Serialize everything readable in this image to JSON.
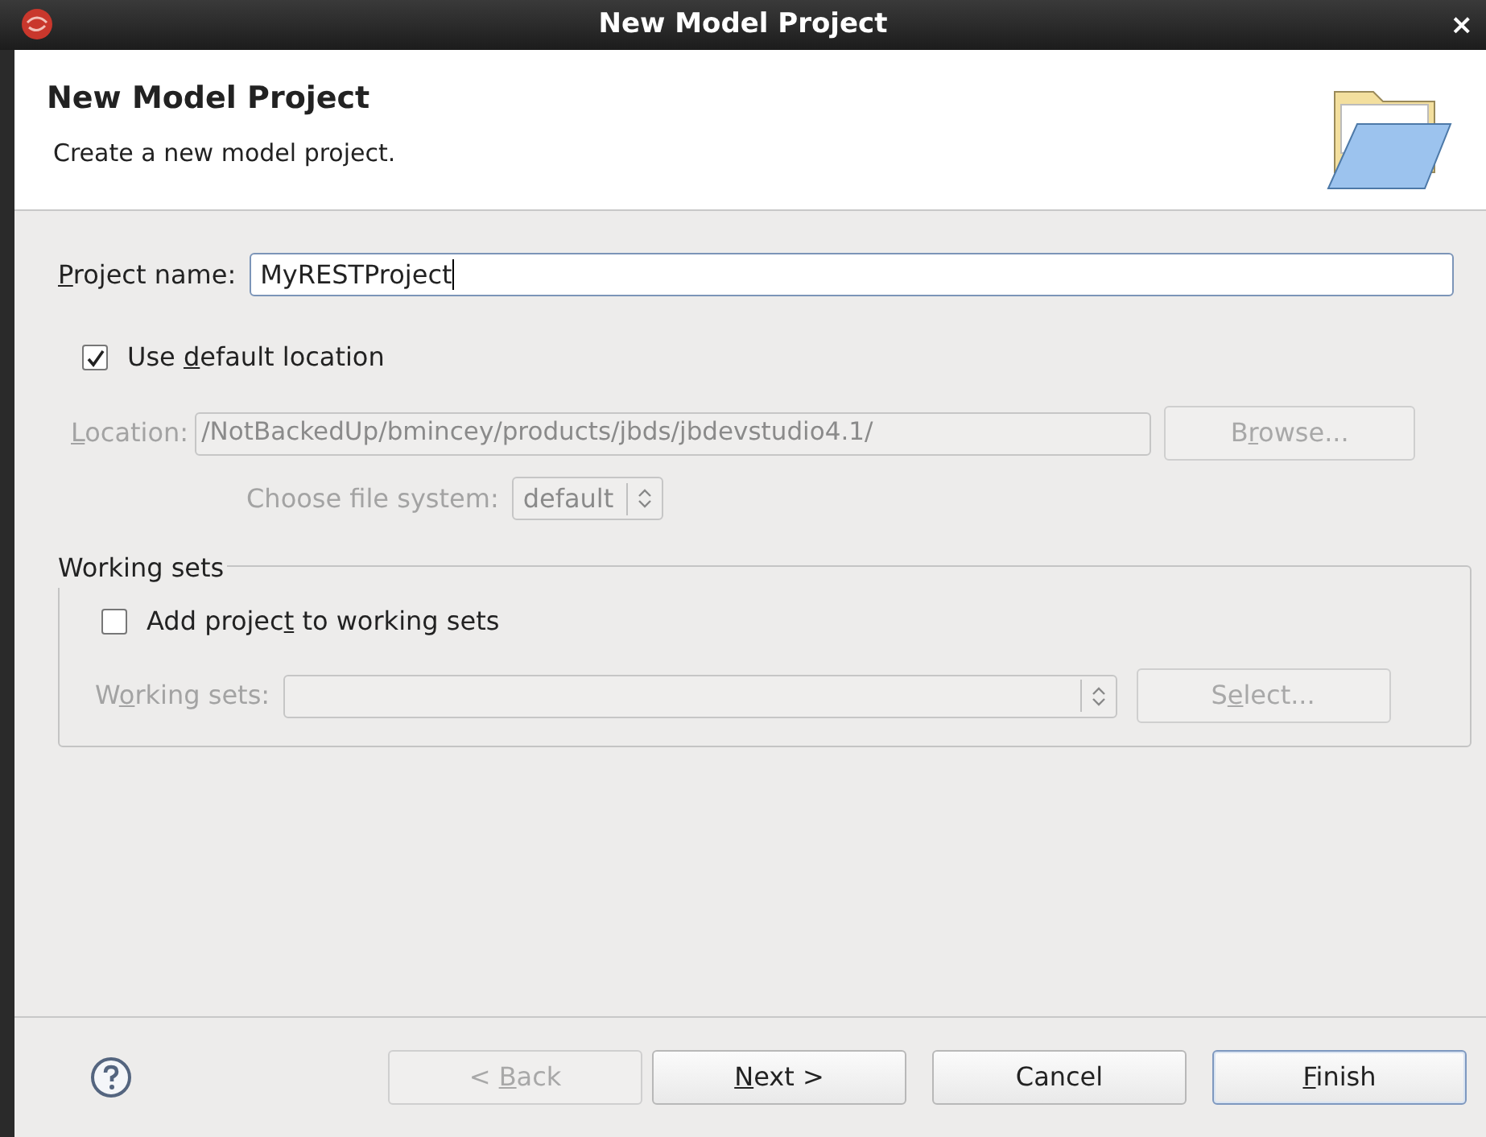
{
  "window": {
    "title": "New Model Project",
    "close": "×"
  },
  "header": {
    "title": "New Model Project",
    "description": "Create a new model project."
  },
  "project_name": {
    "label": [
      {
        "text": "P",
        "underlined": true
      },
      {
        "text": "roject name:",
        "underlined": false
      }
    ],
    "value": "MyRESTProject",
    "focused": true
  },
  "use_default_location": {
    "label": [
      {
        "text": "Use ",
        "underlined": false
      },
      {
        "text": "d",
        "underlined": true
      },
      {
        "text": "efault location",
        "underlined": false
      }
    ],
    "checked": true
  },
  "location": {
    "label": [
      {
        "text": "L",
        "underlined": true
      },
      {
        "text": "ocation:",
        "underlined": false
      }
    ],
    "value": "/NotBackedUp/bmincey/products/jbds/jbdevstudio4.1/",
    "disabled": true
  },
  "browse_button": {
    "label": [
      {
        "text": "B",
        "underlined": false
      },
      {
        "text": "r",
        "underlined": true
      },
      {
        "text": "owse...",
        "underlined": false
      }
    ],
    "disabled": true
  },
  "file_system": {
    "label": "Choose file system:",
    "value": "default",
    "disabled": true
  },
  "working_sets": {
    "title": "Working sets",
    "add_to_working_sets": {
      "label": [
        {
          "text": "Add projec",
          "underlined": false
        },
        {
          "text": "t",
          "underlined": true
        },
        {
          "text": " to working sets",
          "underlined": false
        }
      ],
      "checked": false
    },
    "field": {
      "label": [
        {
          "text": "W",
          "underlined": false
        },
        {
          "text": "o",
          "underlined": true
        },
        {
          "text": "rking sets:",
          "underlined": false
        }
      ],
      "disabled": true
    },
    "select_button": {
      "label": [
        {
          "text": "S",
          "underlined": false
        },
        {
          "text": "e",
          "underlined": true
        },
        {
          "text": "lect...",
          "underlined": false
        }
      ],
      "disabled": true
    }
  },
  "buttons": [
    {
      "label": [
        {
          "text": "< ",
          "underlined": false
        },
        {
          "text": "B",
          "underlined": true
        },
        {
          "text": "ack",
          "underlined": false
        }
      ],
      "disabled": true,
      "default": false
    },
    {
      "label": [
        {
          "text": "N",
          "underlined": true
        },
        {
          "text": "ext >",
          "underlined": false
        }
      ],
      "disabled": false,
      "default": false
    },
    {
      "label": [
        {
          "text": "Cancel",
          "underlined": false
        }
      ],
      "disabled": false,
      "default": false
    },
    {
      "label": [
        {
          "text": "F",
          "underlined": true
        },
        {
          "text": "inish",
          "underlined": false
        }
      ],
      "disabled": false,
      "default": true
    }
  ]
}
